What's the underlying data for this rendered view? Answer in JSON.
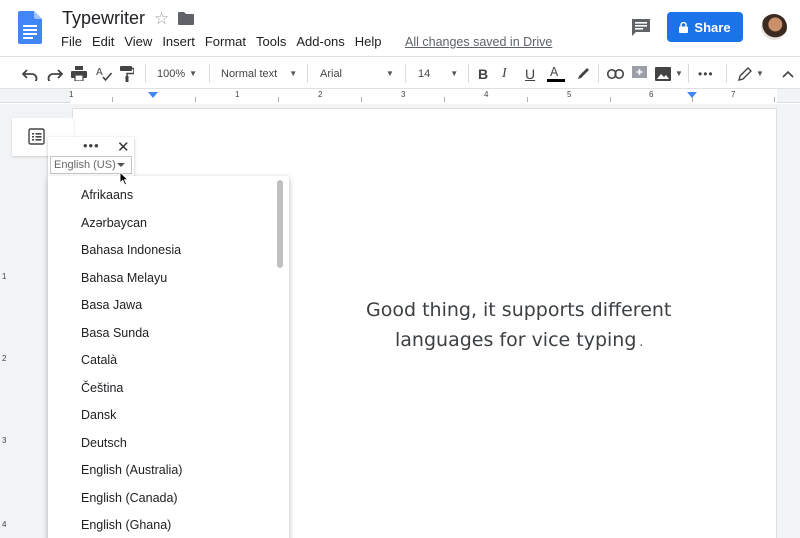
{
  "document": {
    "title": "Typewriter",
    "save_status": "All changes saved in Drive"
  },
  "menubar": {
    "items": [
      "File",
      "Edit",
      "View",
      "Insert",
      "Format",
      "Tools",
      "Add-ons",
      "Help"
    ]
  },
  "header": {
    "share_label": "Share"
  },
  "toolbar": {
    "zoom": "100%",
    "style": "Normal text",
    "font": "Arial",
    "size": "14"
  },
  "ruler": {
    "marks": [
      "1",
      "1",
      "2",
      "3",
      "4",
      "5",
      "6",
      "7"
    ]
  },
  "vertical_ruler": {
    "marks": [
      "1",
      "2",
      "3",
      "4"
    ]
  },
  "voice_typing": {
    "selected_language": "English (US)",
    "more": "•••",
    "close": "✕",
    "languages": [
      "Afrikaans",
      "Azərbaycan",
      "Bahasa Indonesia",
      "Bahasa Melayu",
      "Basa Jawa",
      "Basa Sunda",
      "Català",
      "Čeština",
      "Dansk",
      "Deutsch",
      "English (Australia)",
      "English (Canada)",
      "English (Ghana)"
    ]
  },
  "body_text": {
    "line1": "Good thing, it supports different",
    "line2": "languages for vice typing",
    "trailing": "."
  },
  "colors": {
    "accent": "#1a73e8",
    "docs_blue": "#4285f4",
    "background": "#f1f3f4"
  },
  "icons": [
    "docs-logo",
    "star-icon",
    "folder-icon",
    "comment-icon",
    "lock-icon",
    "undo-icon",
    "redo-icon",
    "print-icon",
    "spellcheck-icon",
    "paint-format-icon",
    "bold-icon",
    "italic-icon",
    "underline-icon",
    "text-color-icon",
    "highlight-icon",
    "link-icon",
    "add-comment-icon",
    "image-icon",
    "more-icon",
    "edit-mode-icon",
    "collapse-icon",
    "outline-icon"
  ]
}
